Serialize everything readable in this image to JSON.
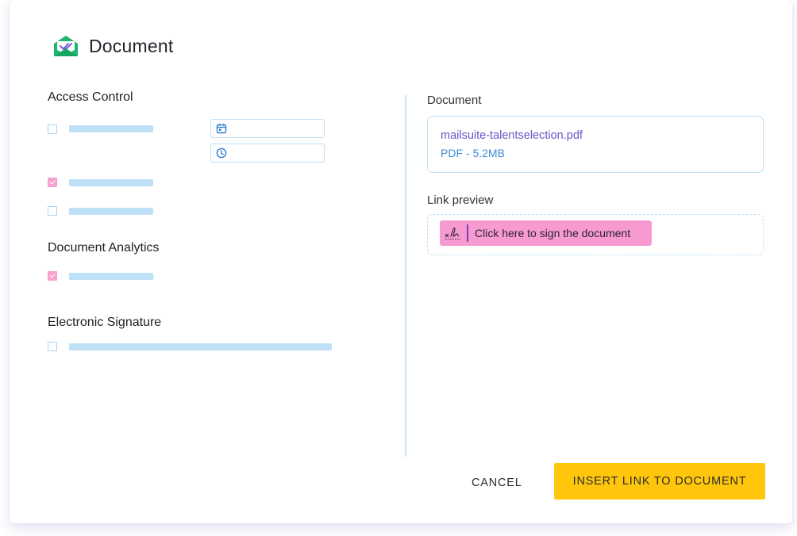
{
  "dialog": {
    "title": "Document",
    "icon": "envelope-check-icon"
  },
  "left": {
    "access_control": {
      "title": "Access Control",
      "options": [
        {
          "checked": false
        },
        {
          "checked": true
        },
        {
          "checked": false
        }
      ],
      "date_field_icon": "calendar-icon",
      "time_field_icon": "clock-icon"
    },
    "document_analytics": {
      "title": "Document Analytics",
      "options": [
        {
          "checked": true
        }
      ]
    },
    "electronic_signature": {
      "title": "Electronic Signature",
      "options": [
        {
          "checked": false
        }
      ]
    }
  },
  "right": {
    "document_label": "Document",
    "file_name": "mailsuite-talentselection.pdf",
    "file_meta": "PDF - 5.2MB",
    "link_preview_label": "Link preview",
    "sign_link_text": "Click here to sign the document",
    "sign_icon": "signature-icon"
  },
  "footer": {
    "cancel_label": "CANCEL",
    "insert_label": "INSERT LINK TO DOCUMENT"
  },
  "colors": {
    "accent_yellow": "#ffc60b",
    "pink": "#f79ad0",
    "light_blue": "#bfe1f7",
    "link_purple": "#6b53c8",
    "meta_blue": "#3c8fd6",
    "logo_green": "#1db66f"
  }
}
